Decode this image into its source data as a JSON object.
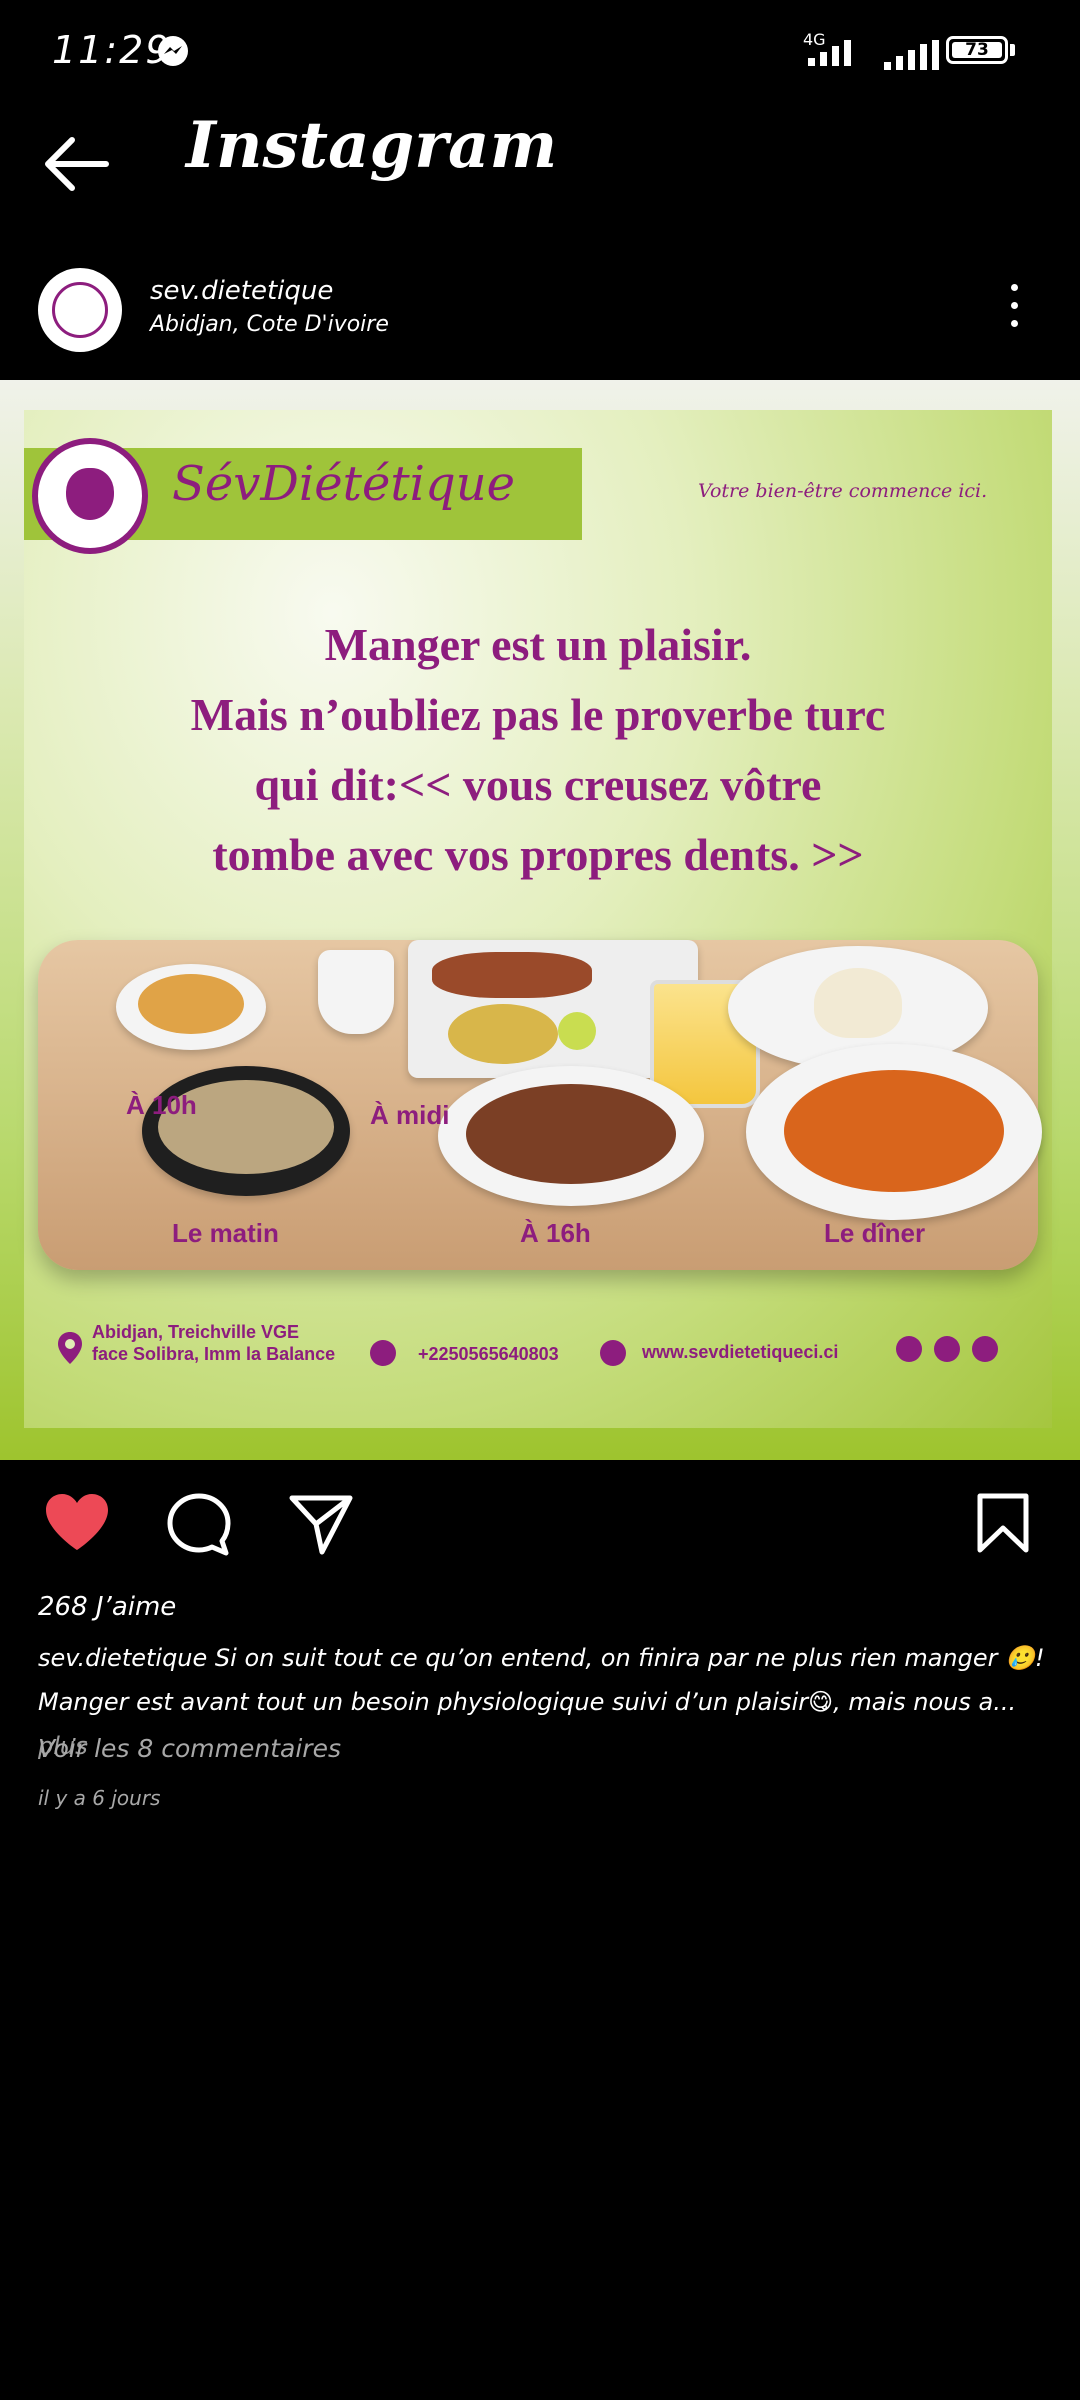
{
  "status_bar": {
    "time": "11:29",
    "network": "4G",
    "battery": "73"
  },
  "header": {
    "title": "Instagram"
  },
  "post": {
    "username": "sev.dietetique",
    "location": "Abidjan, Cote D'ivoire",
    "image": {
      "brand": "SévDiététique",
      "tagline": "Votre bien-être commence ici.",
      "quote_lines": [
        "Manger est un plaisir.",
        "Mais n’oubliez pas le proverbe turc",
        "qui dit:<< vous creusez vôtre",
        "tombe avec vos propres dents. >>"
      ],
      "meals": {
        "ten": "À 10h",
        "noon": "À midi",
        "morning": "Le matin",
        "four": "À 16h",
        "dinner": "Le dîner"
      },
      "address_line1": "Abidjan, Treichville VGE",
      "address_line2": "face Solibra, Imm la Balance",
      "phone": "+2250565640803",
      "website": "www.sevdietetiqueci.ci"
    },
    "likes": "268 J’aime",
    "caption_user": "sev.dietetique",
    "caption_line1": " Si on suit tout ce qu’on entend, on finira par ne plus rien manger 🥲!",
    "caption_line2": "Manger est avant tout un besoin physiologique suivi d’un plaisir😋, mais nous a...",
    "caption_more": " plus",
    "comments_link": "Voir les 8 commentaires",
    "date": "il y a 6 jours"
  },
  "colors": {
    "like": "#ed4956",
    "brand_purple": "#8d1d7e",
    "brand_green": "#9fc43a"
  }
}
